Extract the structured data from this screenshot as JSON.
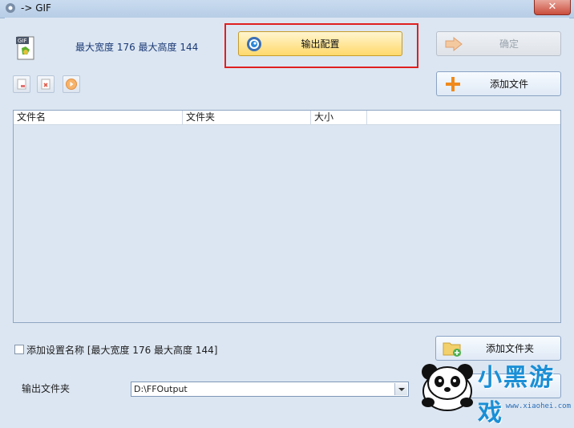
{
  "window": {
    "title": "-> GIF",
    "close_glyph": "✕"
  },
  "header": {
    "dims_text": "最大宽度 176 最大高度 144"
  },
  "buttons": {
    "output_config": "输出配置",
    "confirm": "确定",
    "add_file": "添加文件",
    "add_folder": "添加文件夹"
  },
  "table": {
    "columns": [
      "文件名",
      "文件夹",
      "大小"
    ],
    "rows": []
  },
  "options": {
    "add_setting_label": "添加设置名称 [最大宽度 176 最大高度 144]",
    "add_setting_checked": false
  },
  "output": {
    "label": "输出文件夹",
    "folder_value": "D:\\FFOutput"
  },
  "watermark": {
    "title": "小黑游戏",
    "url": "www.xiaohei.com"
  },
  "colors": {
    "highlight": "#e02020",
    "accent": "#ffd96b"
  }
}
